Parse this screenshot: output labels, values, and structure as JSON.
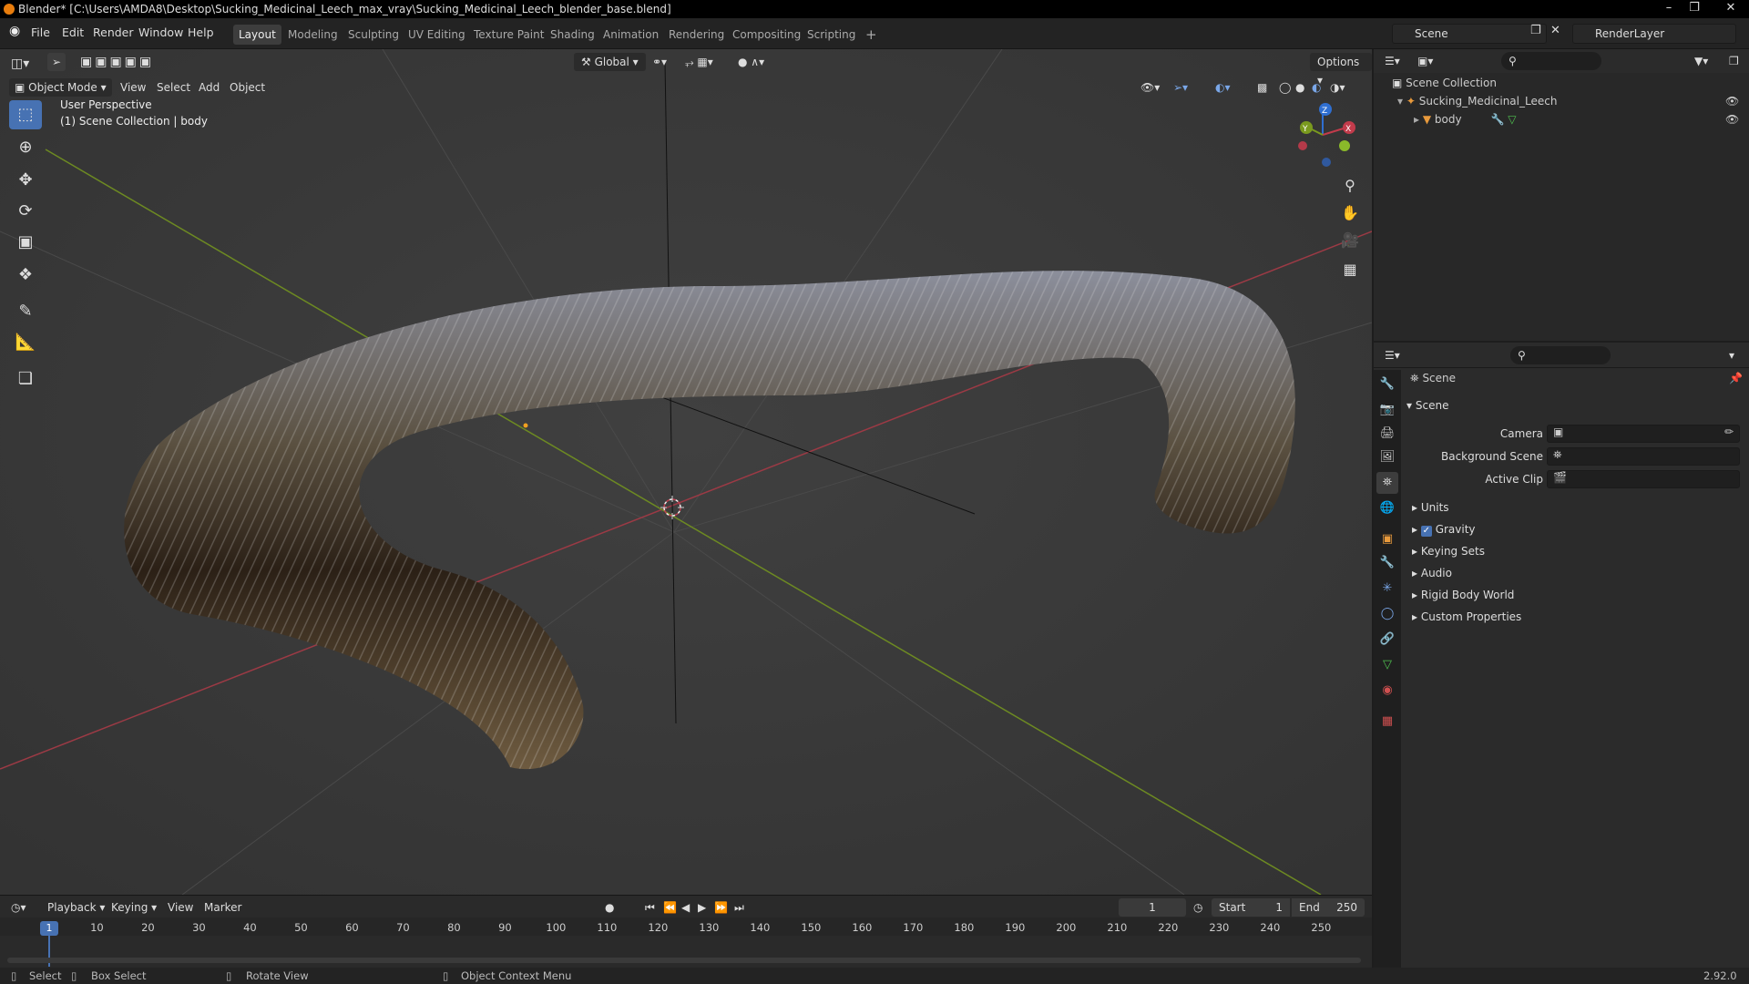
{
  "titlebar": {
    "title": "Blender* [C:\\Users\\AMDA8\\Desktop\\Sucking_Medicinal_Leech_max_vray\\Sucking_Medicinal_Leech_blender_base.blend]"
  },
  "menu": {
    "file": "File",
    "edit": "Edit",
    "render": "Render",
    "window": "Window",
    "help": "Help"
  },
  "workspaces": [
    "Layout",
    "Modeling",
    "Sculpting",
    "UV Editing",
    "Texture Paint",
    "Shading",
    "Animation",
    "Rendering",
    "Compositing",
    "Scripting"
  ],
  "scene": {
    "scene_name": "Scene",
    "view_layer": "RenderLayer"
  },
  "viewport": {
    "mode": "Object Mode",
    "view_menu": "View",
    "select_menu": "Select",
    "add_menu": "Add",
    "object_menu": "Object",
    "orientation": "Global",
    "options": "Options",
    "perspective": "User Perspective",
    "context": "(1) Scene Collection | body",
    "gizmo": {
      "x": "X",
      "y": "Y",
      "z": "Z"
    }
  },
  "timeline": {
    "playback": "Playback",
    "keying": "Keying",
    "view": "View",
    "marker": "Marker",
    "current_frame": "1",
    "start_label": "Start",
    "start_value": "1",
    "end_label": "End",
    "end_value": "250",
    "frame_ticks": [
      "1",
      "10",
      "20",
      "30",
      "40",
      "50",
      "60",
      "70",
      "80",
      "90",
      "100",
      "110",
      "120",
      "130",
      "140",
      "150",
      "160",
      "170",
      "180",
      "190",
      "200",
      "210",
      "220",
      "230",
      "240",
      "250"
    ]
  },
  "outliner": {
    "root": "Scene Collection",
    "collection": "Sucking_Medicinal_Leech",
    "object": "body"
  },
  "properties": {
    "breadcrumb": "Scene",
    "panel_title": "Scene",
    "camera_label": "Camera",
    "background_scene_label": "Background Scene",
    "active_clip_label": "Active Clip",
    "subpanels": [
      "Units",
      "Gravity",
      "Keying Sets",
      "Audio",
      "Rigid Body World",
      "Custom Properties"
    ],
    "gravity_checked": true
  },
  "statusbar": {
    "select": "Select",
    "box_select": "Box Select",
    "rotate_view": "Rotate View",
    "context_menu": "Object Context Menu",
    "version": "2.92.0"
  },
  "colors": {
    "accent": "#4772b3",
    "x_axis": "#c23b4b",
    "y_axis": "#7a9a1e",
    "z_axis": "#2f6fd1"
  }
}
